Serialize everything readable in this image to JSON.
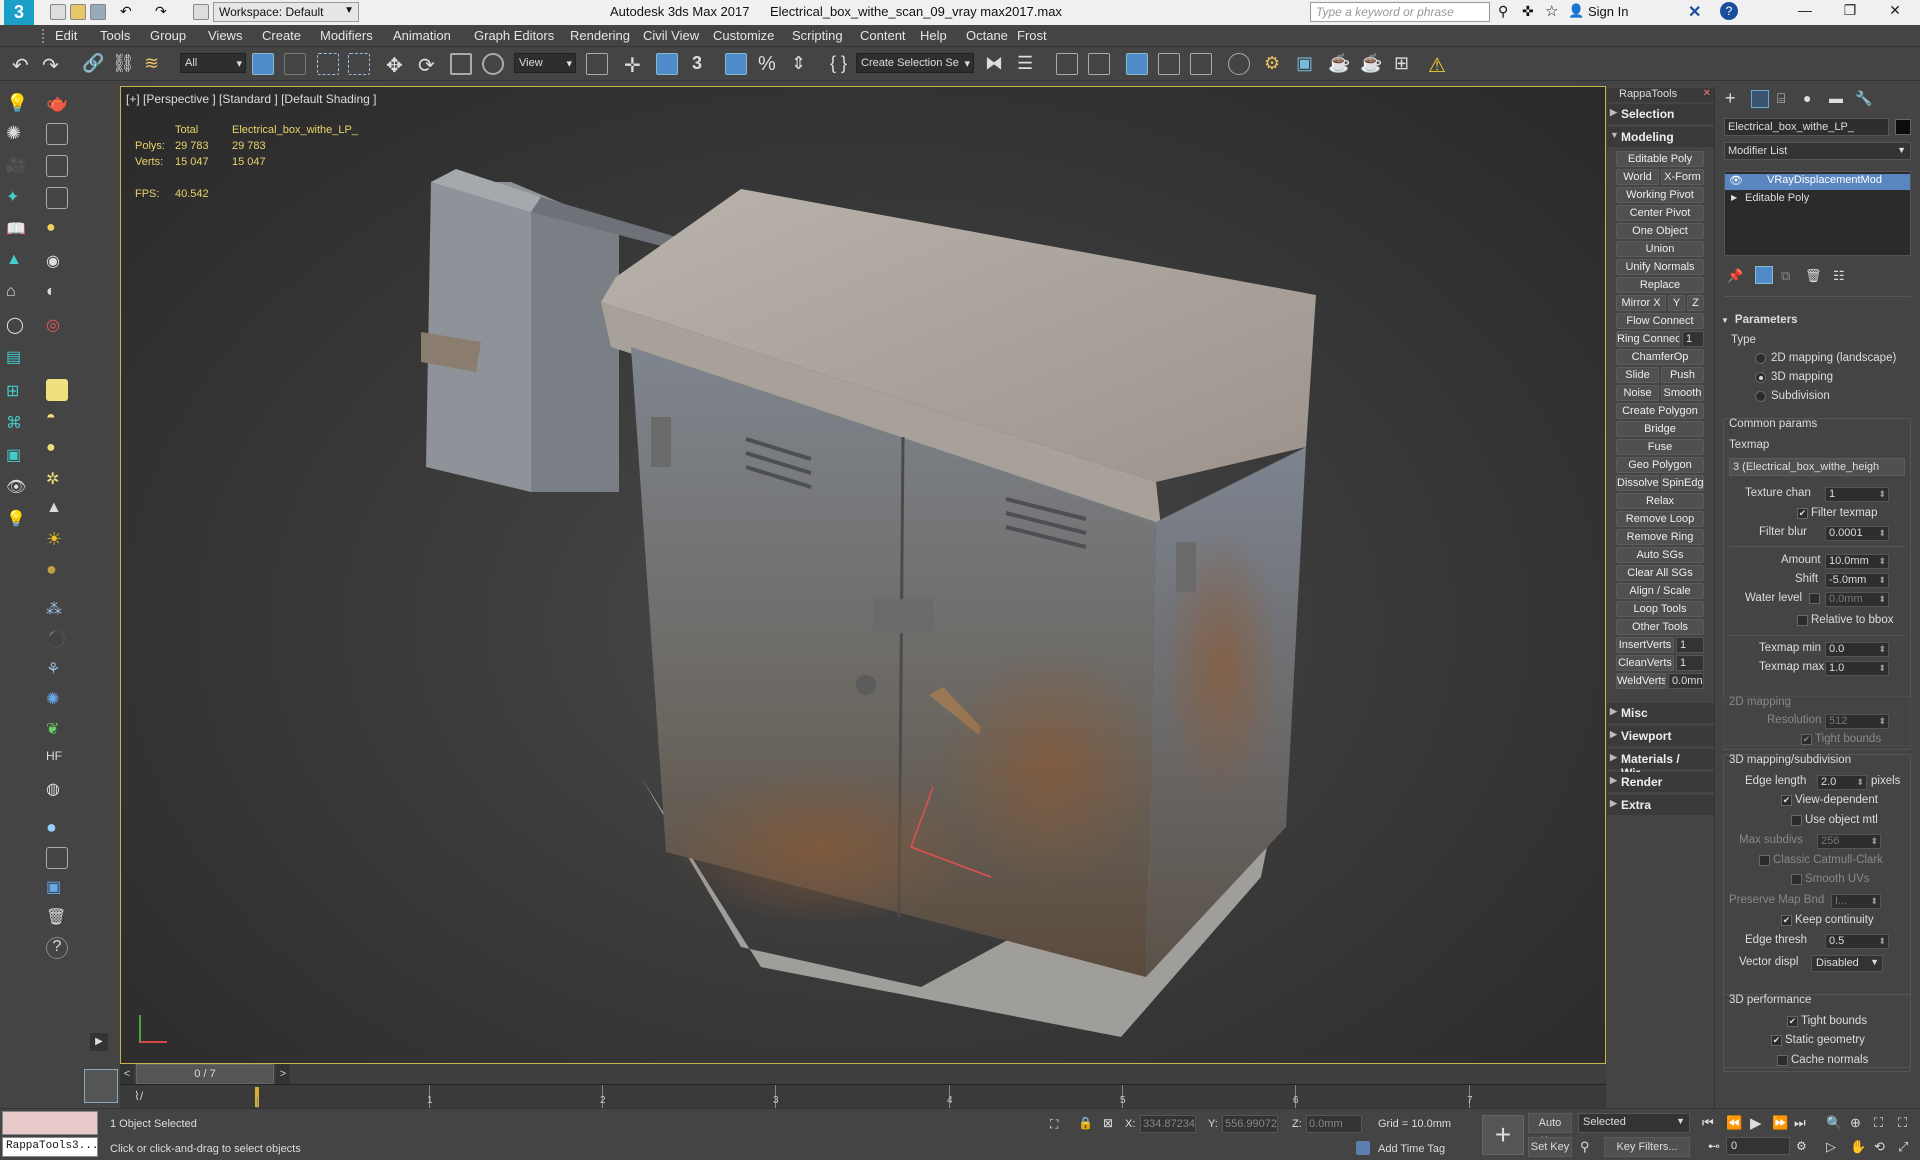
{
  "titlebar": {
    "workspace": "Workspace: Default",
    "app_title": "Autodesk 3ds Max 2017",
    "file_title": "Electrical_box_withe_scan_09_vray max2017.max",
    "search_placeholder": "Type a keyword or phrase",
    "sign_in": "Sign In"
  },
  "menu": [
    "Edit",
    "Tools",
    "Group",
    "Views",
    "Create",
    "Modifiers",
    "Animation",
    "Graph Editors",
    "Rendering",
    "Civil View",
    "Customize",
    "Scripting",
    "Content",
    "Help",
    "Octane",
    "Frost"
  ],
  "toolbar": {
    "filter_all": "All",
    "view_select": "View",
    "selection_set": "Create Selection Se"
  },
  "viewport": {
    "label": "[+] [Perspective ] [Standard ] [Default Shading ]",
    "stats": {
      "total_label": "Total",
      "object_label": "Electrical_box_withe_LP_",
      "polys_label": "Polys:",
      "polys_total": "29 783",
      "polys_obj": "29 783",
      "verts_label": "Verts:",
      "verts_total": "15 047",
      "verts_obj": "15 047",
      "fps_label": "FPS:",
      "fps_value": "40.542"
    }
  },
  "rappatools": {
    "title": "RappaTools",
    "sections": [
      "Selection",
      "Modeling",
      "Misc",
      "Viewport",
      "Materials / Wir",
      "Render",
      "Extra"
    ],
    "buttons": {
      "editable_poly": "Editable Poly",
      "world": "World",
      "xform": "X-Form",
      "working_pivot": "Working Pivot",
      "center_pivot": "Center Pivot",
      "one_object": "One Object",
      "union": "Union",
      "unify_normals": "Unify Normals",
      "replace": "Replace",
      "mirror_x": "Mirror X",
      "y": "Y",
      "z": "Z",
      "flow_connect": "Flow Connect",
      "ring_connect": "Ring Connect",
      "ring_val": "1",
      "chamferop": "ChamferOp",
      "slide": "Slide",
      "push": "Push",
      "noise": "Noise",
      "smooth": "Smooth",
      "create_polygon": "Create Polygon",
      "bridge": "Bridge",
      "fuse": "Fuse",
      "geo_polygon": "Geo Polygon",
      "dissolve": "Dissolve",
      "spinedge": "SpinEdge",
      "relax": "Relax",
      "remove_loop": "Remove Loop",
      "remove_ring": "Remove Ring",
      "auto_sgs": "Auto SGs",
      "clear_all_sgs": "Clear All SGs",
      "align_scale": "Align / Scale",
      "loop_tools": "Loop Tools",
      "other_tools": "Other Tools",
      "insertverts": "InsertVerts",
      "insertverts_val": "1",
      "cleanverts": "CleanVerts",
      "cleanverts_val": "1",
      "weldverts": "WeldVerts",
      "weldverts_val": "0.0mn"
    }
  },
  "command_panel": {
    "object_name": "Electrical_box_withe_LP_",
    "modifier_list": "Modifier List",
    "stack": [
      "VRayDisplacementMod",
      "Editable Poly"
    ],
    "parameters": "Parameters",
    "type_label": "Type",
    "type_options": [
      "2D mapping (landscape)",
      "3D mapping",
      "Subdivision"
    ],
    "common_params": "Common params",
    "texmap_label": "Texmap",
    "texmap_value": "3 (Electrical_box_withe_heigh",
    "texture_chan_label": "Texture chan",
    "texture_chan": "1",
    "filter_texmap": "Filter texmap",
    "filter_blur_label": "Filter blur",
    "filter_blur": "0.0001",
    "amount_label": "Amount",
    "amount": "10.0mm",
    "shift_label": "Shift",
    "shift": "-5.0mm",
    "water_level_label": "Water level",
    "water_level": "0.0mm",
    "relative_bbox": "Relative to bbox",
    "texmap_min_label": "Texmap min",
    "texmap_min": "0.0",
    "texmap_max_label": "Texmap max",
    "texmap_max": "1.0",
    "mapping2d": "2D mapping",
    "resolution_label": "Resolution",
    "resolution": "512",
    "tight_bounds_2d": "Tight bounds",
    "mapping3d": "3D mapping/subdivision",
    "edge_length_label": "Edge length",
    "edge_length": "2.0",
    "pixels": "pixels",
    "view_dependent": "View-dependent",
    "use_object_mtl": "Use object mtl",
    "max_subdivs_label": "Max subdivs",
    "max_subdivs": "256",
    "classic_catmull": "Classic Catmull-Clark",
    "smooth_uvs": "Smooth UVs",
    "preserve_map_bnd_label": "Preserve Map Bnd",
    "preserve_map_bnd": "I...",
    "keep_continuity": "Keep continuity",
    "edge_thresh_label": "Edge thresh",
    "edge_thresh": "0.5",
    "vector_displ_label": "Vector displ",
    "vector_displ": "Disabled",
    "perf": "3D performance",
    "tight_bounds": "Tight bounds",
    "static_geometry": "Static geometry",
    "cache_normals": "Cache normals"
  },
  "timeline": {
    "frame_counter": "0 / 7",
    "ticks": [
      "0",
      "1",
      "2",
      "3",
      "4",
      "5",
      "6",
      "7"
    ]
  },
  "status": {
    "script_box": "RappaTools3...",
    "selected": "1 Object Selected",
    "prompt": "Click or click-and-drag to select objects",
    "x_label": "X:",
    "x_value": "334.87234",
    "y_label": "Y:",
    "y_value": "556.99072",
    "z_label": "Z:",
    "z_value": "0.0mm",
    "grid": "Grid = 10.0mm",
    "add_time_tag": "Add Time Tag",
    "auto_key": "Auto Key",
    "set_key": "Set Key",
    "selected_dd": "Selected",
    "key_filters": "Key Filters...",
    "frame_value": "0"
  }
}
